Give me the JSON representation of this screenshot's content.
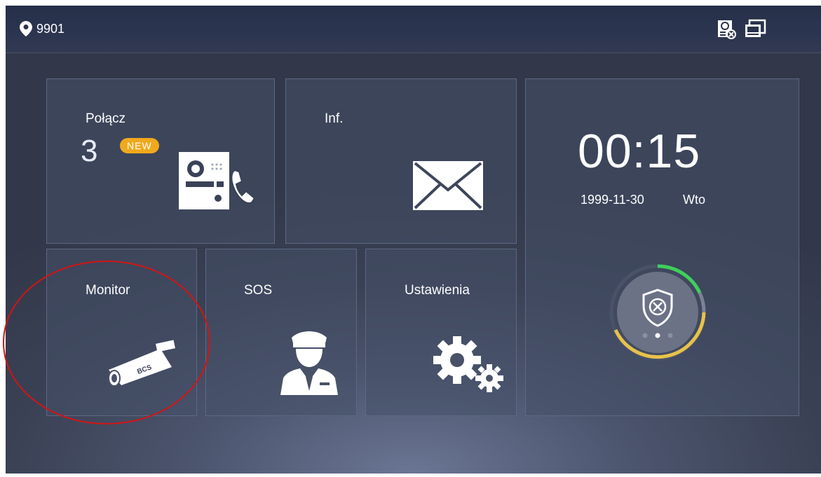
{
  "topbar": {
    "location_icon": "map-pin-icon",
    "room_number": "9901",
    "status_icons": [
      "intercom-offline-icon",
      "monitor-screens-icon"
    ]
  },
  "tiles": {
    "call": {
      "label": "Połącz",
      "count": "3",
      "badge": "NEW",
      "icon": "door-station-phone-icon"
    },
    "info": {
      "label": "Inf.",
      "icon": "envelope-icon"
    },
    "monitor": {
      "label": "Monitor",
      "icon": "cctv-camera-icon",
      "camera_brand": "BCS"
    },
    "sos": {
      "label": "SOS",
      "icon": "security-guard-icon"
    },
    "settings": {
      "label": "Ustawienia",
      "icon": "gears-icon"
    },
    "clock": {
      "time": "00:15",
      "date": "1999-11-30",
      "day": "Wto",
      "alarm_icon": "shield-disarmed-icon",
      "page_dots": 3,
      "active_dot": 2
    }
  },
  "colors": {
    "badge": "#f0a91d",
    "ring_green": "#3fcf5a",
    "ring_yellow": "#e8c24a",
    "annotation_circle": "#d41414"
  }
}
